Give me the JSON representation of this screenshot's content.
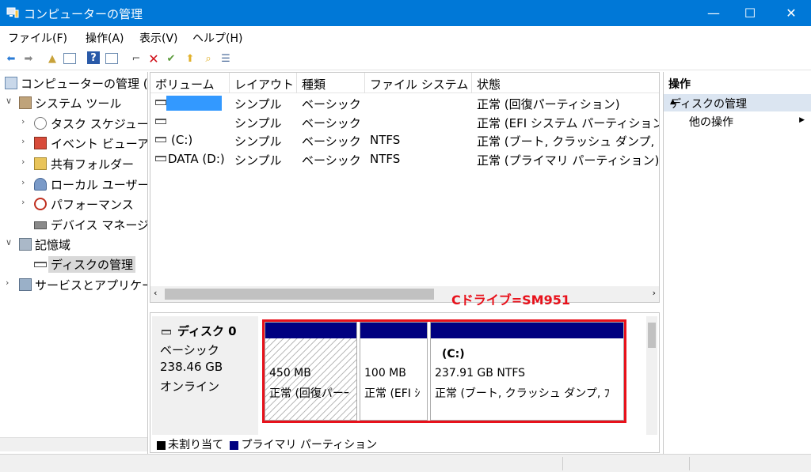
{
  "window": {
    "title": "コンピューターの管理",
    "controls": [
      "—",
      "☐",
      "✕"
    ]
  },
  "menu": [
    "ファイル(F)",
    "操作(A)",
    "表示(V)",
    "ヘルプ(H)"
  ],
  "tree": {
    "items": [
      {
        "label": "コンピューターの管理 (",
        "level": 0,
        "expander": ""
      },
      {
        "label": "システム ツール",
        "level": 1,
        "expander": "∨"
      },
      {
        "label": "タスク スケジュー",
        "level": 2,
        "expander": "›"
      },
      {
        "label": "イベント ビューア",
        "level": 2,
        "expander": "›"
      },
      {
        "label": "共有フォルダー",
        "level": 2,
        "expander": "›"
      },
      {
        "label": "ローカル ユーザー",
        "level": 2,
        "expander": "›"
      },
      {
        "label": "パフォーマンス",
        "level": 2,
        "expander": "›"
      },
      {
        "label": "デバイス マネージ",
        "level": 2,
        "expander": ""
      },
      {
        "label": "記憶域",
        "level": 1,
        "expander": "∨"
      },
      {
        "label": "ディスクの管理",
        "level": 2,
        "expander": "",
        "selected": true
      },
      {
        "label": "サービスとアプリケー",
        "level": 1,
        "expander": "›"
      }
    ]
  },
  "volumes": {
    "headers": [
      "ボリューム",
      "レイアウト",
      "種類",
      "ファイル システム",
      "状態"
    ],
    "rows": [
      {
        "volume": "",
        "layout": "シンプル",
        "type": "ベーシック",
        "fs": "",
        "status": "正常 (回復パーティション)"
      },
      {
        "volume": "",
        "layout": "シンプル",
        "type": "ベーシック",
        "fs": "",
        "status": "正常 (EFI システム パーティション"
      },
      {
        "volume": "(C:)",
        "layout": "シンプル",
        "type": "ベーシック",
        "fs": "NTFS",
        "status": "正常 (ブート, クラッシュ ダンプ, ﾌ"
      },
      {
        "volume": "DATA (D:)",
        "layout": "シンプル",
        "type": "ベーシック",
        "fs": "NTFS",
        "status": "正常 (プライマリ パーティション)"
      }
    ]
  },
  "annotation": "Cドライブ=SM951",
  "disk": {
    "name": "ディスク 0",
    "type": "ベーシック",
    "size": "238.46 GB",
    "state": "オンライン",
    "partitions": [
      {
        "label": "",
        "size": "450 MB",
        "status": "正常 (回復パーｰ"
      },
      {
        "label": "",
        "size": "100 MB",
        "status": "正常 (EFI ｼ"
      },
      {
        "label": "(C:)",
        "size": "237.91 GB NTFS",
        "status": "正常 (ブート, クラッシュ ダンプ, ﾌ"
      }
    ]
  },
  "legend": {
    "unallocated": "未割り当て",
    "primary": "プライマリ パーティション"
  },
  "actions": {
    "header": "操作",
    "section": "ディスクの管理",
    "item": "他の操作"
  },
  "colors": {
    "titlebar": "#0078d7",
    "partition_bar": "#000080",
    "highlight": "#e8111b",
    "action_section": "#dbe5f1"
  }
}
